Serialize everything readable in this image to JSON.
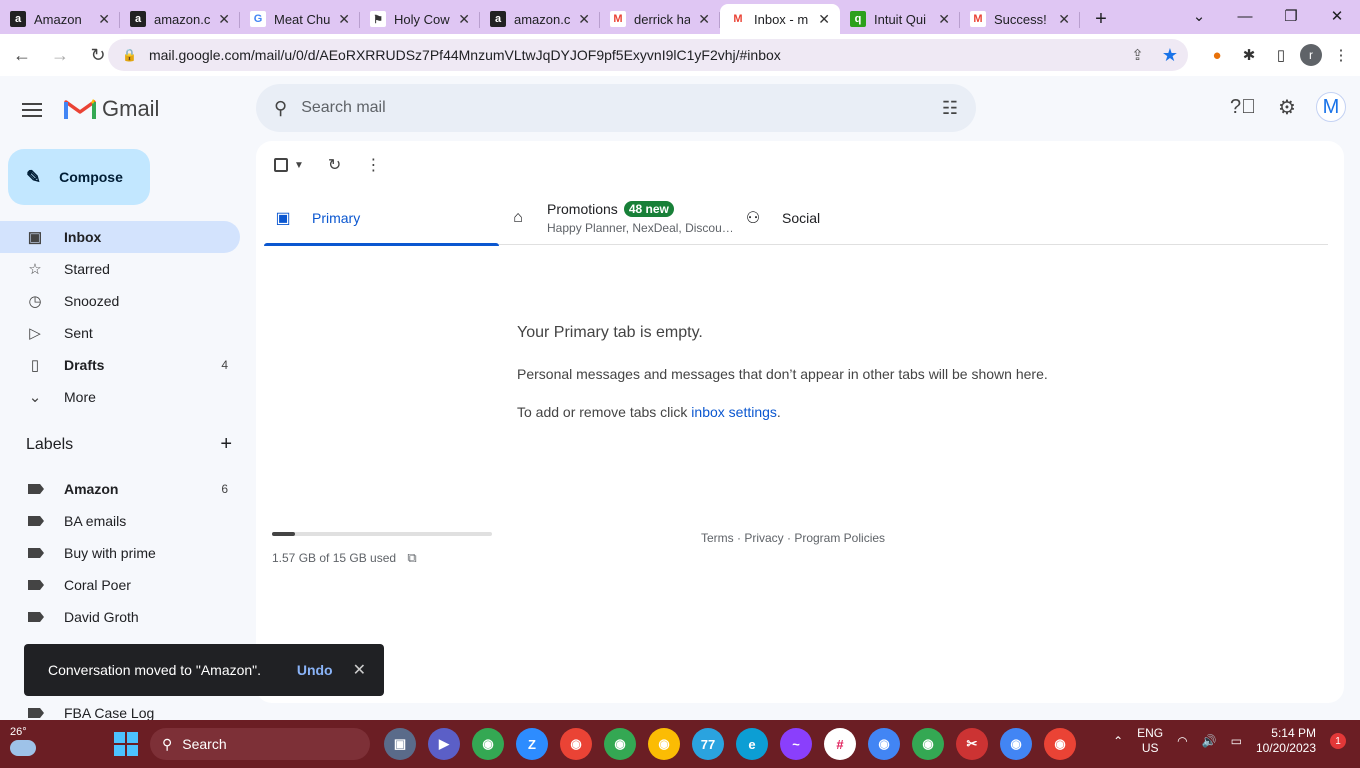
{
  "browser_tabs": [
    {
      "title": "Amazon",
      "icon": "amazon-icon",
      "active": false
    },
    {
      "title": "amazon.c",
      "icon": "amazon-icon",
      "active": false
    },
    {
      "title": "Meat Chu",
      "icon": "google-icon",
      "active": false
    },
    {
      "title": "Holy Cow",
      "icon": "site-icon",
      "active": false
    },
    {
      "title": "amazon.c",
      "icon": "amazon-icon",
      "active": false
    },
    {
      "title": "derrick ha",
      "icon": "gmail-icon",
      "active": false
    },
    {
      "title": "Inbox - m",
      "icon": "gmail-icon",
      "active": true
    },
    {
      "title": "Intuit Qui",
      "icon": "quickbooks-icon",
      "active": false
    },
    {
      "title": "Success!",
      "icon": "gmail-icon",
      "active": false
    }
  ],
  "address_bar": {
    "url": "mail.google.com/mail/u/0/d/AEoRXRRUDSz7Pf44MnzumVLtwJqDYJOF9pf5ExyvnI9lC1yF2vhj/#inbox",
    "profile_initial": "r"
  },
  "gmail": {
    "brand": "Gmail",
    "search_placeholder": "Search mail",
    "avatar_initial": "M",
    "compose_label": "Compose",
    "nav": [
      {
        "label": "Inbox",
        "icon": "inbox-icon",
        "count": "",
        "selected": true
      },
      {
        "label": "Starred",
        "icon": "star-icon",
        "count": "",
        "selected": false
      },
      {
        "label": "Snoozed",
        "icon": "clock-icon",
        "count": "",
        "selected": false
      },
      {
        "label": "Sent",
        "icon": "send-icon",
        "count": "",
        "selected": false
      },
      {
        "label": "Drafts",
        "icon": "draft-icon",
        "count": "4",
        "selected": false,
        "bold": true
      },
      {
        "label": "More",
        "icon": "chevron-down-icon",
        "count": "",
        "selected": false
      }
    ],
    "labels_title": "Labels",
    "labels": [
      {
        "label": "Amazon",
        "count": "6",
        "bold": true
      },
      {
        "label": "BA emails",
        "count": ""
      },
      {
        "label": "Buy with prime",
        "count": ""
      },
      {
        "label": "Coral Poer",
        "count": ""
      },
      {
        "label": "David Groth",
        "count": ""
      },
      {
        "label": "",
        "count": ""
      },
      {
        "label": "",
        "count": ""
      },
      {
        "label": "FBA Case Log",
        "count": ""
      }
    ],
    "inbox_tabs": [
      {
        "label": "Primary",
        "sub": "",
        "badge": "",
        "active": true
      },
      {
        "label": "Promotions",
        "sub": "Happy Planner, NexDeal, Discou…",
        "badge": "48 new",
        "active": false
      },
      {
        "label": "Social",
        "sub": "",
        "badge": "",
        "active": false
      }
    ],
    "empty": {
      "title": "Your Primary tab is empty.",
      "line1": "Personal messages and messages that don’t appear in other tabs will be shown here.",
      "line2_prefix": "To add or remove tabs click ",
      "line2_link": "inbox settings",
      "line2_suffix": "."
    },
    "storage": {
      "text": "1.57 GB of 15 GB used",
      "fraction": 0.105
    },
    "footer": "Terms · Privacy · Program Policies",
    "toast": {
      "message": "Conversation moved to \"Amazon\".",
      "action": "Undo"
    }
  },
  "taskbar": {
    "temperature": "26°",
    "search_label": "Search",
    "language": "ENG",
    "region": "US",
    "time": "5:14 PM",
    "date": "10/20/2023",
    "notifications": "1",
    "telegram_badge": "77"
  },
  "colors": {
    "tab_bar": "#dfc6f3",
    "taskbar": "#6b1e24",
    "accent": "#0b57d0",
    "badge_green": "#188038"
  }
}
